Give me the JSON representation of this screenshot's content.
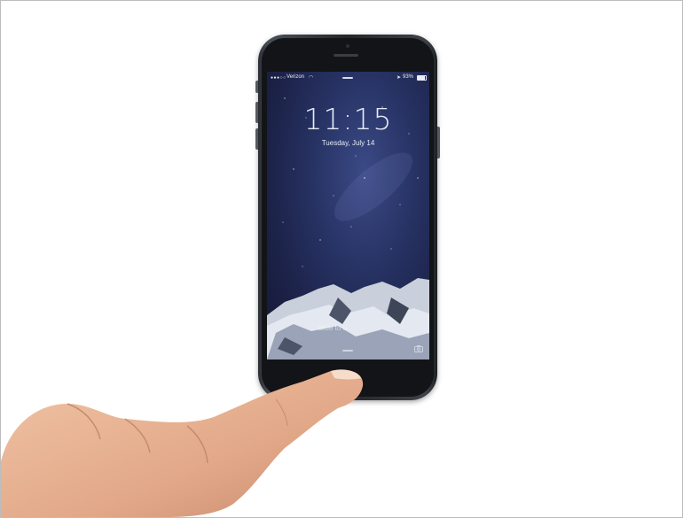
{
  "lock_screen": {
    "carrier": "Verizon",
    "battery_percent": "93%",
    "time": "11:15",
    "date": "Tuesday, July 14",
    "slide_text": "slide to u"
  },
  "icons": {
    "signal": "signal-dots-icon",
    "wifi": "wifi-icon",
    "location": "location-arrow-icon",
    "battery": "battery-icon",
    "camera": "camera-icon"
  },
  "colors": {
    "screen_wallpaper": "#283466",
    "phone_body": "#2a2d32",
    "skin": "#e8b99a"
  }
}
